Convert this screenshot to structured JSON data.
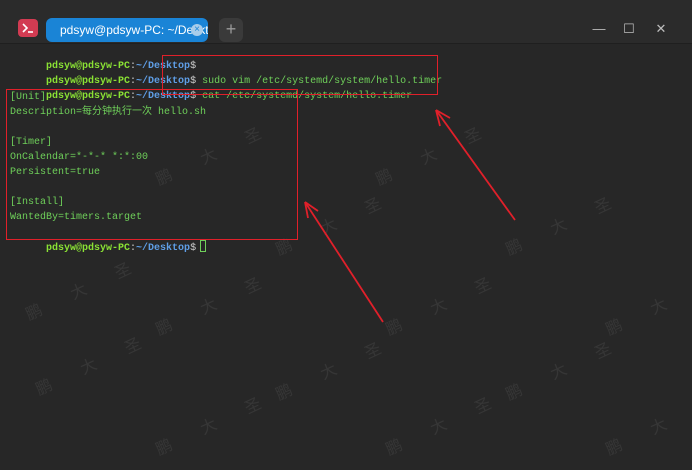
{
  "window": {
    "tab_title": "pdsyw@pdsyw-PC: ~/Desktop",
    "new_tab_label": "+",
    "tab_close_glyph": "×",
    "minimize_glyph": "—",
    "maximize_glyph": "☐",
    "close_glyph": "✕"
  },
  "prompt": {
    "user_host": "pdsyw@pdsyw-PC",
    "colon": ":",
    "path": "~/Desktop",
    "dollar": "$"
  },
  "commands": {
    "cmd1": " sudo vim /etc/systemd/system/hello.timer",
    "cmd2": " cat /etc/systemd/system/hello.timer"
  },
  "file_lines": [
    "[Unit]",
    "Description=每分钟执行一次 hello.sh",
    "",
    "[Timer]",
    "OnCalendar=*-*-* *:*:00",
    "Persistent=true",
    "",
    "[Install]",
    "WantedBy=timers.target"
  ],
  "watermark_text": "鹏 大 圣",
  "colors": {
    "annotation": "#e0202a",
    "tab_active": "#1a84d6",
    "prompt_green": "#8ae234",
    "path_blue": "#5f9ee6"
  }
}
